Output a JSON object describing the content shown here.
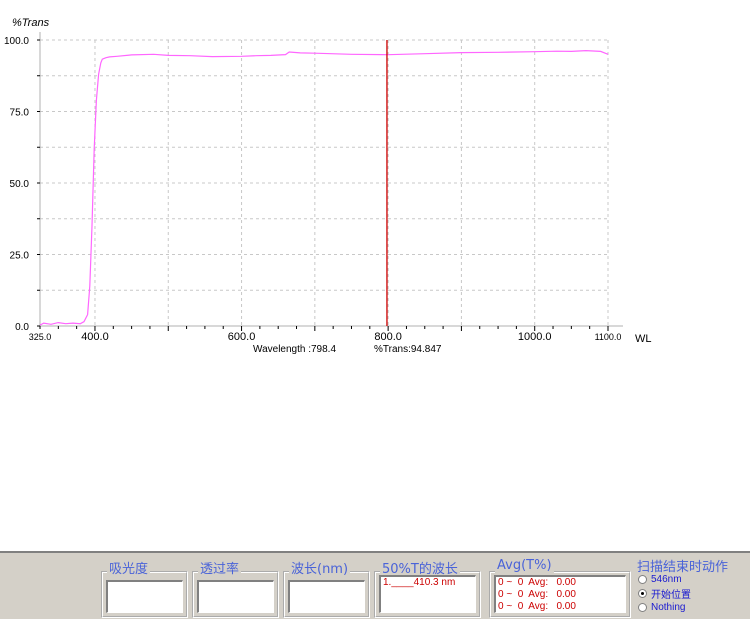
{
  "chart_data": {
    "type": "line",
    "ylabel": "%Trans",
    "xlabel": "WL",
    "xlim": [
      325,
      1100
    ],
    "ylim": [
      0,
      100
    ],
    "x_ticks": [
      "325.0",
      "400.0",
      "600.0",
      "800.0",
      "1000.0",
      "1100.0"
    ],
    "y_ticks": [
      "0.0",
      "25.0",
      "50.0",
      "75.0",
      "100.0"
    ],
    "grid": true,
    "series": [
      {
        "color": "#ff66ff",
        "x": [
          325,
          330,
          340,
          350,
          360,
          370,
          380,
          385,
          390,
          393,
          396,
          399,
          402,
          405,
          408,
          410,
          412,
          415,
          420,
          430,
          450,
          480,
          500,
          530,
          560,
          600,
          620,
          640,
          660,
          665,
          680,
          700,
          750,
          800,
          850,
          900,
          950,
          1000,
          1030,
          1050,
          1070,
          1090,
          1100
        ],
        "y": [
          0.3,
          1.0,
          0.6,
          1.2,
          0.8,
          1.0,
          0.8,
          1.5,
          4,
          14,
          35,
          62,
          79,
          88,
          92,
          93.3,
          93.5,
          93.8,
          94.1,
          94.3,
          94.8,
          95.0,
          94.6,
          94.5,
          94.2,
          94.3,
          94.5,
          94.6,
          94.9,
          95.8,
          95.5,
          95.4,
          95.0,
          94.85,
          95.2,
          95.6,
          95.7,
          95.9,
          96.1,
          96.0,
          96.3,
          96.0,
          95.0
        ]
      }
    ],
    "cursor": {
      "x": 798.4,
      "color": "#cc0000"
    },
    "readout": {
      "wavelength": "Wavelength :798.4",
      "trans": "%Trans:94.847"
    }
  },
  "panel": {
    "absorbance_title": "吸光度",
    "transmittance_title": "透过率",
    "wavelength_title": "波长(nm)",
    "t50_title": "50%T的波长",
    "t50_row": "1.____410.3 nm",
    "avg_title": "Avg(T%)",
    "avg_rows": [
      "0 ~  0  Avg:   0.00",
      "0 ~  0  Avg:   0.00",
      "0 ~  0  Avg:   0.00"
    ],
    "scan_end_title": "扫描结束时动作",
    "options": [
      {
        "label": "546nm",
        "selected": false
      },
      {
        "label": "开始位置",
        "selected": true
      },
      {
        "label": "Nothing",
        "selected": false
      }
    ]
  }
}
